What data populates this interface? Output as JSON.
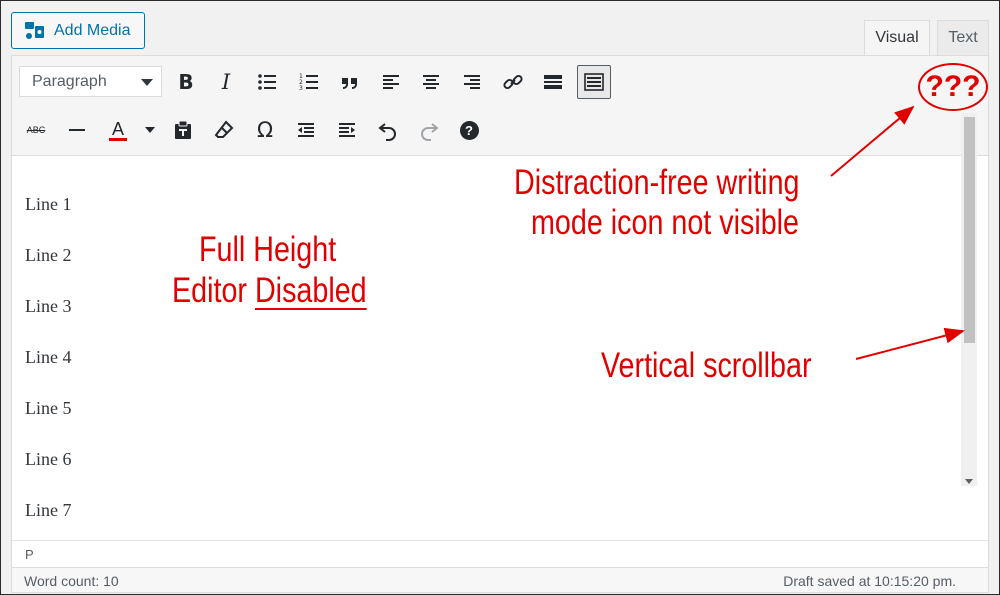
{
  "top_bar": {
    "add_media_label": "Add Media",
    "tabs": [
      {
        "label": "Visual",
        "active": true
      },
      {
        "label": "Text",
        "active": false
      }
    ]
  },
  "toolbar": {
    "format_select_value": "Paragraph",
    "row1_icons": [
      "bold-icon",
      "italic-icon",
      "bulleted-list-icon",
      "numbered-list-icon",
      "blockquote-icon",
      "align-left-icon",
      "align-center-icon",
      "align-right-icon",
      "link-icon",
      "read-more-icon",
      "toolbar-toggle-icon"
    ],
    "row2_icons": [
      "strikethrough-icon",
      "horizontal-line-icon",
      "text-color-icon",
      "text-color-dropdown-icon",
      "paste-as-text-icon",
      "clear-formatting-icon",
      "special-character-icon",
      "outdent-icon",
      "indent-icon",
      "undo-icon",
      "redo-icon",
      "help-icon"
    ],
    "bold_glyph": "B",
    "italic_glyph": "I",
    "strike_glyph": "ABC",
    "text_color_glyph": "A",
    "omega_glyph": "Ω",
    "help_glyph": "?"
  },
  "content": {
    "lines": [
      "Line 1",
      "Line 2",
      "Line 3",
      "Line 4",
      "Line 5",
      "Line 6",
      "Line 7"
    ]
  },
  "path_bar": {
    "path": "P"
  },
  "status_bar": {
    "word_count": "Word count: 10",
    "draft_saved": "Draft saved at 10:15:20 pm."
  },
  "annotations": {
    "ring_text": "???",
    "dfw_line1": "Distraction-free writing",
    "dfw_line2": "mode icon not visible",
    "fh_line1": "Full Height",
    "fh_line2_prefix": "Editor",
    "fh_line2_underlined": "Disabled",
    "scrollbar_note": "Vertical scrollbar",
    "color": "#e00000"
  },
  "colors": {
    "accent": "#0073aa",
    "toolbar_bg": "#f5f5f5",
    "text_color_underline": "#e00000"
  }
}
